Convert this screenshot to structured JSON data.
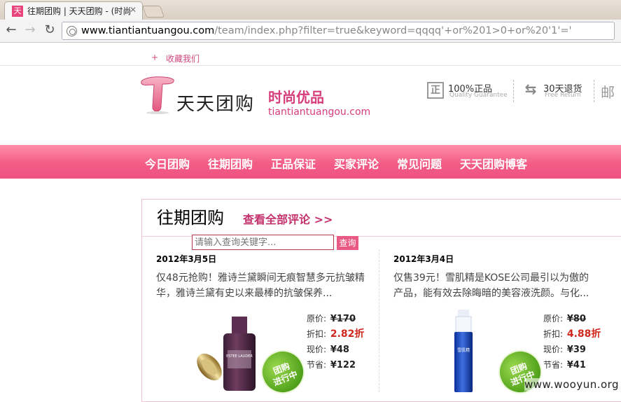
{
  "browser": {
    "tab_title": "往期团购 | 天天团购 - (时尚",
    "favicon_char": "天",
    "url_host": "www.tiantiantuangou.com",
    "url_path": "/team/index.php?filter=true&keyword=qqqq'+or%201>0+or%20'1'='"
  },
  "topbar": {
    "favorite_label": "收藏我们"
  },
  "header": {
    "logo_text": "天天团购",
    "slogan": "时尚优品",
    "domain": "tiantiantuangou.com",
    "guarantees": [
      {
        "title": "100%正品",
        "subtitle": "Quality Guarantee",
        "icon": "genuine-icon",
        "glyph": "正"
      },
      {
        "title": "30天退货",
        "subtitle": "Free Return",
        "icon": "return-icon",
        "glyph": "⇆"
      }
    ],
    "partial_glyph": "邮"
  },
  "nav": {
    "items": [
      "今日团购",
      "往期团购",
      "正品保证",
      "买家评论",
      "常见问题",
      "天天团购博客"
    ]
  },
  "main": {
    "title": "往期团购",
    "all_reviews_link": "查看全部评论 >>",
    "search": {
      "placeholder": "请输入查询关键字...",
      "button": "查询"
    },
    "deals": [
      {
        "date": "2012年3月5日",
        "description": "仅48元抢购！雅诗兰黛瞬间无痕智慧多元抗皱精华，雅诗兰黛有史以来最棒的抗皱保养...",
        "labels": {
          "original": "原价:",
          "discount": "折扣:",
          "current": "现价:",
          "saved": "节省:"
        },
        "original_price": "¥170",
        "discount": "2.82折",
        "current_price": "¥48",
        "saved": "¥122",
        "badge": "团购\n进行中",
        "product_label": "ESTEE LAUDER"
      },
      {
        "date": "2012年3月4日",
        "description": "仅售39元！雪肌精是KOSE公司最引以为傲的产品，能有效去除晦暗的美容液洗颜。与化...",
        "labels": {
          "original": "原价:",
          "discount": "折扣:",
          "current": "现价:",
          "saved": "节省:"
        },
        "original_price": "¥80",
        "discount": "4.88折",
        "current_price": "¥39",
        "saved": "¥41",
        "badge": "团购\n进行中",
        "product_label": "雪肌精"
      }
    ]
  },
  "watermark": "www.wooyun.org",
  "colors": {
    "brand_pink": "#ee5280",
    "accent_red": "#d0271d",
    "badge_green": "#52a21c"
  }
}
